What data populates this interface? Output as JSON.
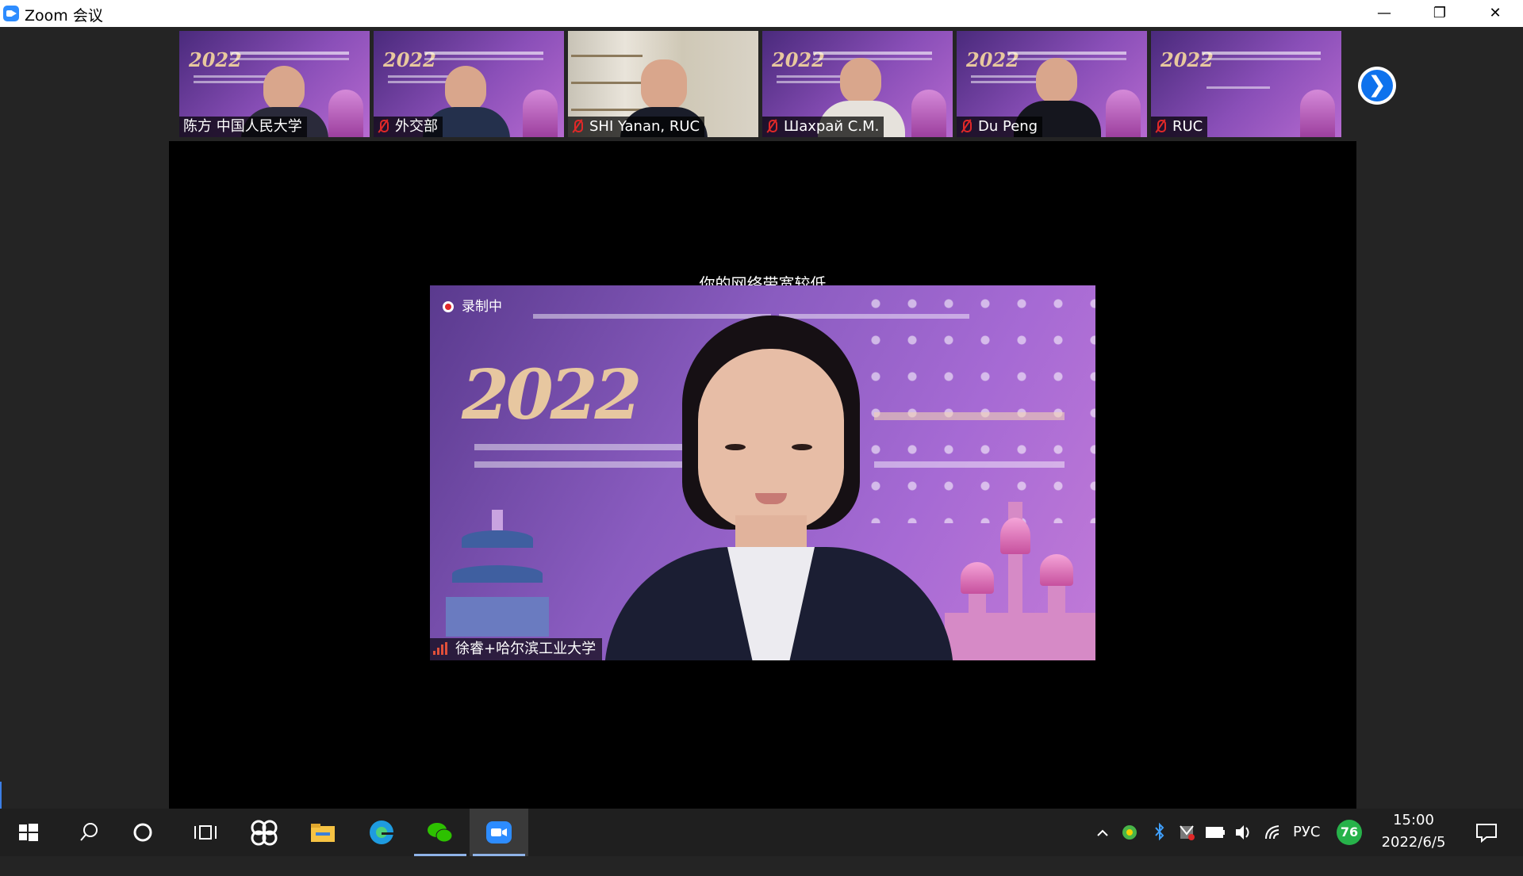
{
  "window": {
    "title": "Zoom 会议",
    "minimize_glyph": "—",
    "restore_glyph": "❐",
    "close_glyph": "✕"
  },
  "thumbnails": [
    {
      "name": "陈方 中国人民大学",
      "muted": false,
      "year": "2022"
    },
    {
      "name": "外交部",
      "muted": true,
      "year": "2022"
    },
    {
      "name": "SHI Yanan, RUC",
      "muted": true,
      "year": ""
    },
    {
      "name": "Шахрай С.М.",
      "muted": true,
      "year": "2022"
    },
    {
      "name": "Du Peng",
      "muted": true,
      "year": "2022"
    },
    {
      "name": "RUC",
      "muted": true,
      "year": "2022"
    }
  ],
  "next_page_glyph": "❯",
  "main": {
    "bandwidth_warning": "你的网络带宽较低",
    "recording_label": "录制中",
    "speaker_name": "徐睿+哈尔滨工业大学",
    "banner_year": "2022"
  },
  "taskbar": {
    "apps": [
      "start-icon",
      "search-icon",
      "cortana-icon",
      "task-view-icon",
      "app-icon",
      "file-explorer-icon",
      "edge-icon",
      "wechat-icon",
      "zoom-icon"
    ],
    "active_app": "zoom-icon",
    "tray": {
      "language": "РУС",
      "badge_value": "76",
      "time": "15:00",
      "date": "2022/6/5"
    }
  },
  "colors": {
    "zoom_blue": "#0e72ed",
    "mute_red": "#e02828",
    "taskbar_bg": "#1f1f1f",
    "meeting_bg": "#242424"
  }
}
